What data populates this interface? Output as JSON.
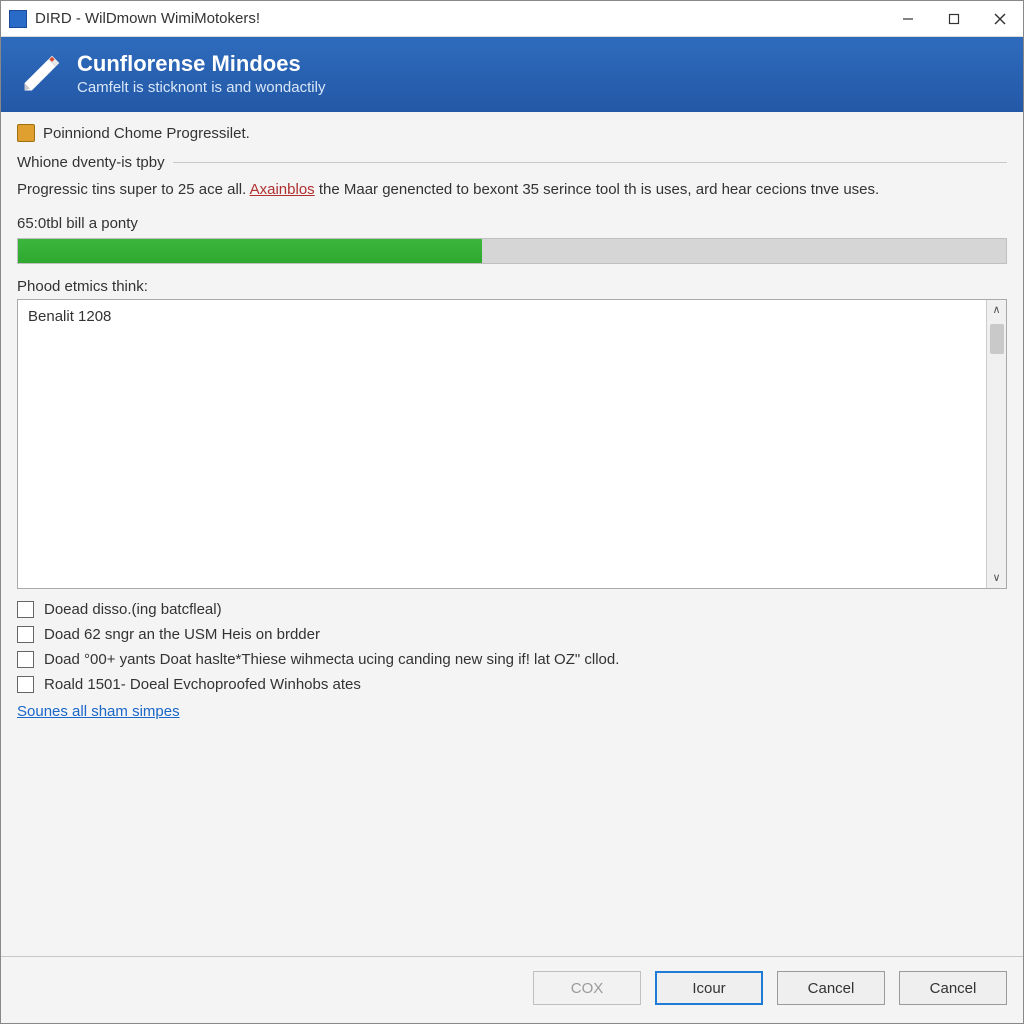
{
  "window": {
    "title": "DIRD - WilDmown WimiMotokers!"
  },
  "header": {
    "title": "Cunflorense Mindoes",
    "subtitle": "Camfelt is sticknont is and wondactily"
  },
  "status": {
    "text": "Poinniond Chome Progressilet."
  },
  "divider_label": "Whione dventy-is tpby",
  "description": {
    "pre": "Progressic tins super to 25 ace all. ",
    "link": "Axainblos",
    "post": " the Maar genencted to bexont 35 serince tool th is uses, ard hear cecions tnve uses."
  },
  "progress": {
    "label": "65:0tbl bill a ponty",
    "percent": 47
  },
  "log": {
    "label": "Phood etmics think:",
    "line1": "Benalit 1208"
  },
  "checks": [
    {
      "label": "Doead disso.(ing batcfleal)"
    },
    {
      "label": "Doad 62 sngr an the USM Heis on brdder"
    },
    {
      "label": "Doad °00+ yants Doat haslte*Thiese wihmecta ucing canding new sing if! lat OZ\" cllod."
    },
    {
      "label": "Roald 1501- Doeal Evchoproofed Winhobs ates"
    }
  ],
  "link_row": {
    "text": "Sounes all sham simpes"
  },
  "buttons": {
    "cox": "COX",
    "icour": "Icour",
    "cancel1": "Cancel",
    "cancel2": "Cancel"
  }
}
